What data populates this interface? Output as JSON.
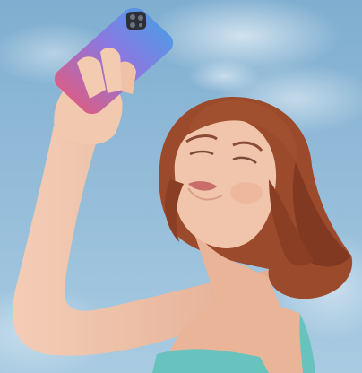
{
  "scene": {
    "subject": "woman-holding-smartphone",
    "colors": {
      "sky_top": "#7faed0",
      "sky_bottom": "#a9cbe2",
      "cloud": "#e4eef5",
      "skin": "#f1c5ab",
      "skin_shadow": "#d99f86",
      "hair": "#9b4a2c",
      "hair_dark": "#6f2f1a",
      "lips": "#c86d6a",
      "top": "#68c3bf",
      "phone_blue": "#3fa5e8",
      "phone_pink": "#f0566e",
      "camera": "#2c2f36"
    }
  }
}
